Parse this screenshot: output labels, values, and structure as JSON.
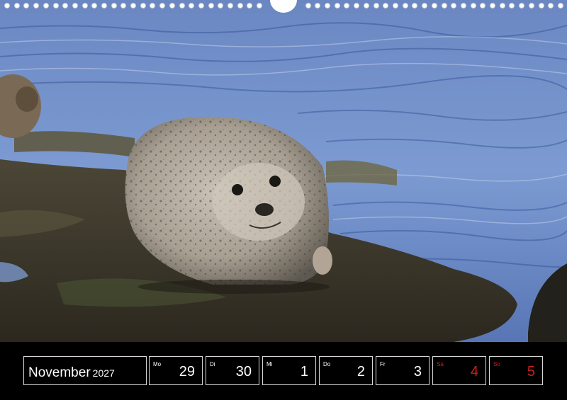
{
  "calendar": {
    "month": "November",
    "year": "2027",
    "days": [
      {
        "abbr": "Mo",
        "num": "29",
        "weekend": false
      },
      {
        "abbr": "Di",
        "num": "30",
        "weekend": false
      },
      {
        "abbr": "Mi",
        "num": "1",
        "weekend": false
      },
      {
        "abbr": "Do",
        "num": "2",
        "weekend": false
      },
      {
        "abbr": "Fr",
        "num": "3",
        "weekend": false
      },
      {
        "abbr": "Sa",
        "num": "4",
        "weekend": true
      },
      {
        "abbr": "So",
        "num": "5",
        "weekend": true
      }
    ]
  },
  "colors": {
    "weekend": "#cc1f1f",
    "border": "#d8d8d8",
    "background": "#000000",
    "water": "#5f7fb8",
    "rock": "#3f3a2c"
  },
  "photo": {
    "subject": "seal-on-rock"
  }
}
